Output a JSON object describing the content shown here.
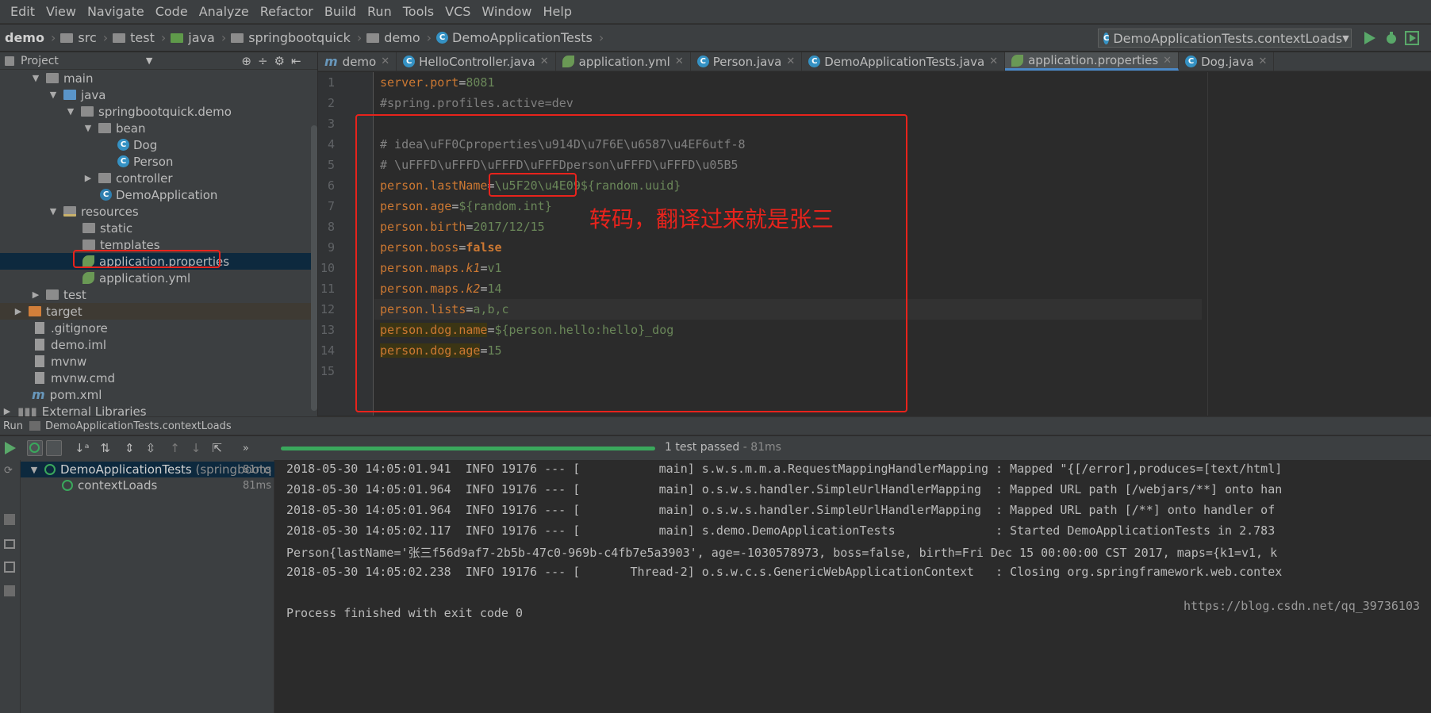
{
  "menu": [
    "Edit",
    "View",
    "Navigate",
    "Code",
    "Analyze",
    "Refactor",
    "Build",
    "Run",
    "Tools",
    "VCS",
    "Window",
    "Help"
  ],
  "breadcrumbs": {
    "project": "demo",
    "items": [
      "src",
      "test",
      "java",
      "springbootquick",
      "demo",
      "DemoApplicationTests"
    ]
  },
  "run_config": "DemoApplicationTests.contextLoads",
  "project_panel": {
    "title": "Project",
    "tree": [
      {
        "label": "main",
        "icon": "folder-icon"
      },
      {
        "label": "java",
        "icon": "folder-icon"
      },
      {
        "label": "springbootquick.demo",
        "icon": "package-icon"
      },
      {
        "label": "bean",
        "icon": "package-icon"
      },
      {
        "label": "Dog",
        "icon": "class-icon"
      },
      {
        "label": "Person",
        "icon": "class-icon"
      },
      {
        "label": "controller",
        "icon": "package-icon"
      },
      {
        "label": "DemoApplication",
        "icon": "spring-class-icon"
      },
      {
        "label": "resources",
        "icon": "resources-folder-icon"
      },
      {
        "label": "static",
        "icon": "folder-icon"
      },
      {
        "label": "templates",
        "icon": "folder-icon"
      },
      {
        "label": "application.properties",
        "icon": "spring-config-icon"
      },
      {
        "label": "application.yml",
        "icon": "spring-config-icon"
      },
      {
        "label": "test",
        "icon": "folder-icon"
      },
      {
        "label": "target",
        "icon": "folder-icon"
      },
      {
        "label": ".gitignore",
        "icon": "file-icon"
      },
      {
        "label": "demo.iml",
        "icon": "file-icon"
      },
      {
        "label": "mvnw",
        "icon": "file-icon"
      },
      {
        "label": "mvnw.cmd",
        "icon": "file-icon"
      },
      {
        "label": "pom.xml",
        "icon": "maven-icon"
      },
      {
        "label": "External Libraries",
        "icon": "library-icon"
      }
    ]
  },
  "tabs": [
    {
      "label": "demo",
      "icon": "maven-icon"
    },
    {
      "label": "HelloController.java",
      "icon": "class-icon"
    },
    {
      "label": "application.yml",
      "icon": "spring-config-icon"
    },
    {
      "label": "Person.java",
      "icon": "class-icon"
    },
    {
      "label": "DemoApplicationTests.java",
      "icon": "class-icon"
    },
    {
      "label": "application.properties",
      "icon": "spring-config-icon",
      "active": true
    },
    {
      "label": "Dog.java",
      "icon": "class-icon"
    }
  ],
  "editor": {
    "line_numbers": [
      "1",
      "2",
      "3",
      "4",
      "5",
      "6",
      "7",
      "8",
      "9",
      "10",
      "11",
      "12",
      "13",
      "14",
      "15"
    ],
    "lines": {
      "l1_key": "server.port",
      "l1_val": "8081",
      "l2": "#spring.profiles.active=dev",
      "l4": "# idea\\uFF0Cproperties\\u914D\\u7F6E\\u6587\\u4EF6utf-8",
      "l5": "# \\uFFFD\\uFFFD\\uFFFD\\uFFFDperson\\uFFFD\\uFFFD\\u05B5",
      "l6_key": "person.lastName",
      "l6_val": "\\u5F20\\u4E09",
      "l6_ph": "${random.uuid}",
      "l7_key": "person.age",
      "l7_ph": "${random.int}",
      "l8_key": "person.birth",
      "l8_val": "2017/12/15",
      "l9_key": "person.boss",
      "l9_val": "false",
      "l10_key": "person.maps.",
      "l10_sub": "k1",
      "l10_val": "v1",
      "l11_key": "person.maps.",
      "l11_sub": "k2",
      "l11_val": "14",
      "l12_key": "person.lists",
      "l12_val": "a,b,c",
      "l13_key": "person.dog.name",
      "l13_ph": "${person.hello:hello}",
      "l13_val": "_dog",
      "l14_key": "person.dog.age",
      "l14_val": "15"
    }
  },
  "annotation": "转码，翻译过来就是张三",
  "run_panel": {
    "title": "Run",
    "config": "DemoApplicationTests.contextLoads",
    "status": "1 test passed",
    "status_time": "- 81ms",
    "progress": 1.0,
    "tests": [
      {
        "label": "DemoApplicationTests",
        "suffix": "(springbootq",
        "time": "81ms"
      },
      {
        "label": "contextLoads",
        "suffix": "",
        "time": "81ms"
      }
    ],
    "console": [
      "2018-05-30 14:05:01.941  INFO 19176 --- [           main] s.w.s.m.m.a.RequestMappingHandlerMapping : Mapped \"{[/error],produces=[text/html]",
      "2018-05-30 14:05:01.964  INFO 19176 --- [           main] o.s.w.s.handler.SimpleUrlHandlerMapping  : Mapped URL path [/webjars/**] onto han",
      "2018-05-30 14:05:01.964  INFO 19176 --- [           main] o.s.w.s.handler.SimpleUrlHandlerMapping  : Mapped URL path [/**] onto handler of",
      "2018-05-30 14:05:02.117  INFO 19176 --- [           main] s.demo.DemoApplicationTests              : Started DemoApplicationTests in 2.783",
      "Person{lastName='张三f56d9af7-2b5b-47c0-969b-c4fb7e5a3903', age=-1030578973, boss=false, birth=Fri Dec 15 00:00:00 CST 2017, maps={k1=v1, k",
      "2018-05-30 14:05:02.238  INFO 19176 --- [       Thread-2] o.s.w.c.s.GenericWebApplicationContext   : Closing org.springframework.web.contex",
      "",
      "Process finished with exit code 0"
    ],
    "watermark": "https://blog.csdn.net/qq_39736103"
  }
}
